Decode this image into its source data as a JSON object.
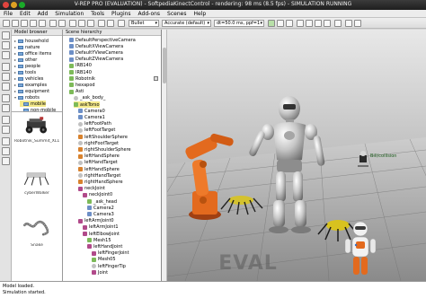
{
  "window": {
    "title": "V-REP PRO (EVALUATION) - SoftpediaKinectControl - rendering: 98 ms (8.5 fps) - SIMULATION RUNNING"
  },
  "menu": [
    "File",
    "Edit",
    "Add",
    "Simulation",
    "Tools",
    "Plugins",
    "Add-ons",
    "Scenes",
    "Help"
  ],
  "toolbar": {
    "engine_combo": "Bullet",
    "accuracy_combo": "Accurate (default)",
    "timestep_combo": "dt=50.0 ms, ppf=1"
  },
  "model_browser": {
    "header": "Model browser",
    "folders": [
      {
        "label": "household",
        "selected": false
      },
      {
        "label": "nature",
        "selected": false
      },
      {
        "label": "office items",
        "selected": false
      },
      {
        "label": "other",
        "selected": false
      },
      {
        "label": "people",
        "selected": false
      },
      {
        "label": "tools",
        "selected": false
      },
      {
        "label": "vehicles",
        "selected": false
      },
      {
        "label": "examples",
        "selected": false
      },
      {
        "label": "equipment",
        "selected": false
      },
      {
        "label": "robots",
        "selected": false
      },
      {
        "label": "mobile",
        "selected": true
      },
      {
        "label": "non-mobile",
        "selected": false
      }
    ],
    "thumbnails": [
      {
        "label": "Robotnik_Summit_XL140701"
      },
      {
        "label": "cyberWalker"
      },
      {
        "label": "Snake"
      }
    ]
  },
  "scene_hierarchy": {
    "header": "Scene hierarchy",
    "rows": [
      {
        "label": "DefaultPerspectiveCamera",
        "icon": "camera",
        "depth": 1
      },
      {
        "label": "DefaultXViewCamera",
        "icon": "camera",
        "depth": 1
      },
      {
        "label": "DefaultYViewCamera",
        "icon": "camera",
        "depth": 1
      },
      {
        "label": "DefaultZViewCamera",
        "icon": "camera",
        "depth": 1
      },
      {
        "label": "IRB140",
        "icon": "shape",
        "depth": 1
      },
      {
        "label": "IRB140",
        "icon": "shape",
        "depth": 1
      },
      {
        "label": "Robotnik",
        "icon": "shape",
        "depth": 1
      },
      {
        "label": "hexapod",
        "icon": "shape",
        "depth": 1
      },
      {
        "label": "Asti",
        "icon": "shape",
        "depth": 1
      },
      {
        "label": "_ask_body_",
        "icon": "dummy",
        "depth": 2
      },
      {
        "label": "askTorso",
        "icon": "shape",
        "depth": 2,
        "selected": true
      },
      {
        "label": "Camera0",
        "icon": "camera",
        "depth": 3
      },
      {
        "label": "Camera1",
        "icon": "camera",
        "depth": 3
      },
      {
        "label": "leftFootPath",
        "icon": "dummy",
        "depth": 3
      },
      {
        "label": "leftFootTarget",
        "icon": "dummy",
        "depth": 3
      },
      {
        "label": "leftShoulderSphere",
        "icon": "sensor",
        "depth": 3
      },
      {
        "label": "rightFootTarget",
        "icon": "dummy",
        "depth": 3
      },
      {
        "label": "rightShoulderSphere",
        "icon": "sensor",
        "depth": 3
      },
      {
        "label": "leftHandSphere",
        "icon": "sensor",
        "depth": 3
      },
      {
        "label": "leftHandTarget",
        "icon": "dummy",
        "depth": 3
      },
      {
        "label": "leftHandSphere",
        "icon": "sensor",
        "depth": 3
      },
      {
        "label": "rightHandTarget",
        "icon": "dummy",
        "depth": 3
      },
      {
        "label": "rightHandSphere",
        "icon": "sensor",
        "depth": 3
      },
      {
        "label": "neckJoint",
        "icon": "joint",
        "depth": 3
      },
      {
        "label": "neckJoint0",
        "icon": "joint",
        "depth": 4
      },
      {
        "label": "_ask_head",
        "icon": "shape",
        "depth": 5
      },
      {
        "label": "Camera2",
        "icon": "camera",
        "depth": 5
      },
      {
        "label": "Camera3",
        "icon": "camera",
        "depth": 5
      },
      {
        "label": "leftArmJoint0",
        "icon": "joint",
        "depth": 3
      },
      {
        "label": "leftArmJoint1",
        "icon": "joint",
        "depth": 4
      },
      {
        "label": "leftElbowJoint",
        "icon": "joint",
        "depth": 4
      },
      {
        "label": "Mesh15",
        "icon": "shape",
        "depth": 5
      },
      {
        "label": "leftHandJoint",
        "icon": "joint",
        "depth": 5
      },
      {
        "label": "leftFingerJoint",
        "icon": "joint",
        "depth": 6
      },
      {
        "label": "Mesh05",
        "icon": "shape",
        "depth": 6
      },
      {
        "label": "leftFingerTip",
        "icon": "dummy",
        "depth": 6
      },
      {
        "label": "Joint",
        "icon": "joint",
        "depth": 6
      }
    ]
  },
  "viewport": {
    "watermark": "EVAL",
    "label_small_robot": "Bill/collision"
  },
  "status": {
    "lines": [
      "Model loaded.",
      "Simulation started."
    ]
  },
  "colors": {
    "floor_light": "#c9c9c9",
    "floor_dark": "#7c7c7c",
    "selection": "#f4e98a",
    "industrial_robot": "#e36a1e"
  }
}
